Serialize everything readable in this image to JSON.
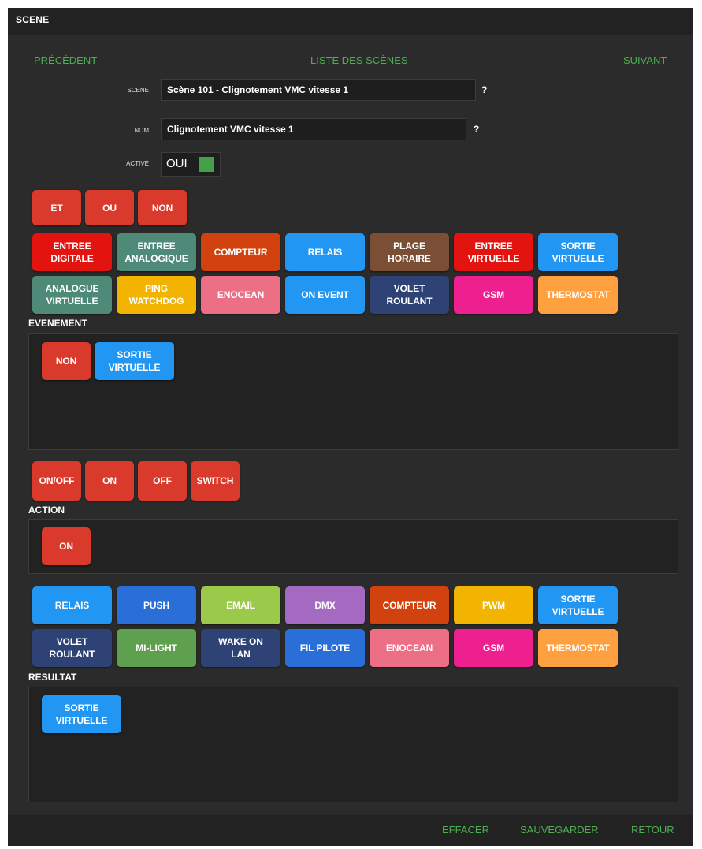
{
  "window": {
    "title": "SCENE"
  },
  "nav": {
    "prev": "PRÉCÉDENT",
    "list": "LISTE DES SCÈNES",
    "next": "SUIVANT"
  },
  "form": {
    "scene_label": "SCENE",
    "scene_value": "Scène 101 - Clignotement VMC vitesse 1",
    "name_label": "NOM",
    "name_value": "Clignotement VMC vitesse 1",
    "active_label": "ACTIVÉ",
    "active_value": "OUI",
    "help": "?",
    "active_color": "#43a047"
  },
  "logic_buttons": [
    {
      "label": "ET",
      "color": "#d93a2b"
    },
    {
      "label": "OU",
      "color": "#d93a2b"
    },
    {
      "label": "NON",
      "color": "#d93a2b"
    }
  ],
  "event_types": [
    {
      "label": "ENTREE\nDIGITALE",
      "color": "#e3140f"
    },
    {
      "label": "ENTREE\nANALOGIQUE",
      "color": "#4f8a78"
    },
    {
      "label": "COMPTEUR",
      "color": "#d1420f"
    },
    {
      "label": "RELAIS",
      "color": "#2196f3"
    },
    {
      "label": "PLAGE\nHORAIRE",
      "color": "#7a4f36"
    },
    {
      "label": "ENTREE\nVIRTUELLE",
      "color": "#e3140f"
    },
    {
      "label": "SORTIE\nVIRTUELLE",
      "color": "#2196f3"
    },
    {
      "label": "ANALOGUE\nVIRTUELLE",
      "color": "#4f8a78"
    },
    {
      "label": "PING\nWATCHDOG",
      "color": "#f2b400"
    },
    {
      "label": "ENOCEAN",
      "color": "#ec6f86"
    },
    {
      "label": "ON EVENT",
      "color": "#2196f3"
    },
    {
      "label": "VOLET\nROULANT",
      "color": "#2f4275"
    },
    {
      "label": "GSM",
      "color": "#ee1f8e"
    },
    {
      "label": "THERMOSTAT",
      "color": "#ffa040"
    }
  ],
  "event_section": {
    "label": "EVENEMENT",
    "items": [
      {
        "label": "NON",
        "color": "#d93a2b"
      },
      {
        "label": "SORTIE\nVIRTUELLE",
        "color": "#2196f3"
      }
    ]
  },
  "action_buttons": [
    {
      "label": "ON/OFF",
      "color": "#d93a2b"
    },
    {
      "label": "ON",
      "color": "#d93a2b"
    },
    {
      "label": "OFF",
      "color": "#d93a2b"
    },
    {
      "label": "SWITCH",
      "color": "#d93a2b"
    }
  ],
  "action_section": {
    "label": "ACTION",
    "items": [
      {
        "label": "ON",
        "color": "#d93a2b"
      }
    ]
  },
  "result_types": [
    {
      "label": "RELAIS",
      "color": "#2196f3"
    },
    {
      "label": "PUSH",
      "color": "#2a6fd8"
    },
    {
      "label": "EMAIL",
      "color": "#9bc94a"
    },
    {
      "label": "DMX",
      "color": "#a46ac2"
    },
    {
      "label": "COMPTEUR",
      "color": "#d1420f"
    },
    {
      "label": "PWM",
      "color": "#f2b400"
    },
    {
      "label": "SORTIE\nVIRTUELLE",
      "color": "#2196f3"
    },
    {
      "label": "VOLET\nROULANT",
      "color": "#2f4275"
    },
    {
      "label": "MI-LIGHT",
      "color": "#5fa04e"
    },
    {
      "label": "WAKE ON\nLAN",
      "color": "#2f4275"
    },
    {
      "label": "FIL PILOTE",
      "color": "#2a6fd8"
    },
    {
      "label": "ENOCEAN",
      "color": "#ec6f86"
    },
    {
      "label": "GSM",
      "color": "#ee1f8e"
    },
    {
      "label": "THERMOSTAT",
      "color": "#ffa040"
    }
  ],
  "result_section": {
    "label": "RESULTAT",
    "items": [
      {
        "label": "SORTIE\nVIRTUELLE",
        "color": "#2196f3"
      }
    ]
  },
  "footer": {
    "clear": "EFFACER",
    "save": "SAUVEGARDER",
    "back": "RETOUR"
  }
}
